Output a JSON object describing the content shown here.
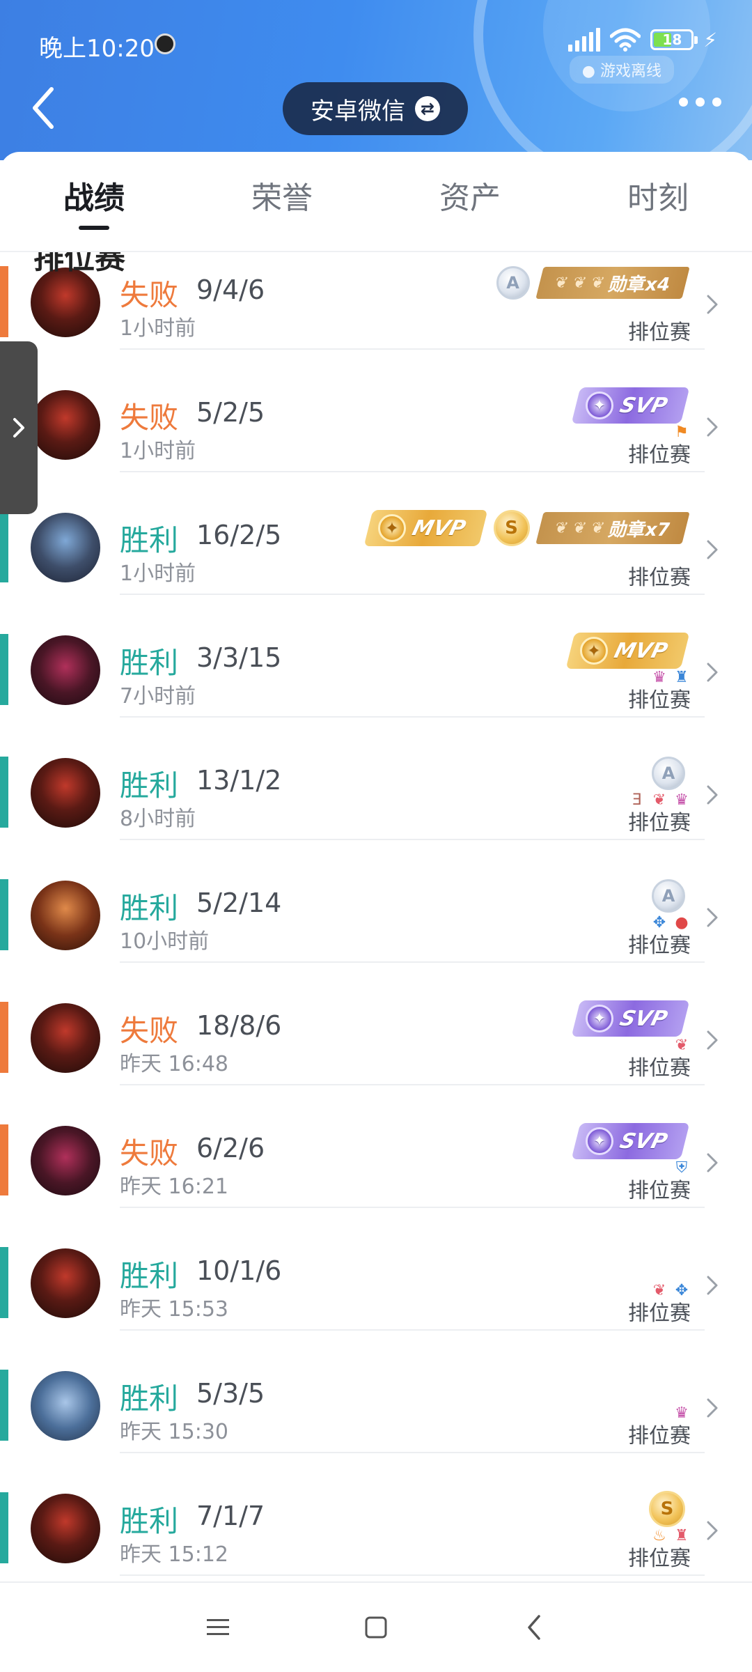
{
  "status_bar": {
    "time": "晚上10:20",
    "battery": "18",
    "game_status": "游戏离线"
  },
  "header": {
    "account": "安卓微信"
  },
  "tabs": [
    {
      "label": "战绩",
      "active": true
    },
    {
      "label": "荣誉",
      "active": false
    },
    {
      "label": "资产",
      "active": false
    },
    {
      "label": "时刻",
      "active": false
    }
  ],
  "section_title": "排位赛",
  "matches": [
    {
      "result": "失败",
      "kda": "9/4/6",
      "time": "1小时前",
      "mode": "排位赛",
      "badges": [
        "A",
        "勋章x4"
      ],
      "extras": []
    },
    {
      "result": "失败",
      "kda": "5/2/5",
      "time": "1小时前",
      "mode": "排位赛",
      "badges": [
        "SVP"
      ],
      "extras": [
        "flag-icon"
      ]
    },
    {
      "result": "胜利",
      "kda": "16/2/5",
      "time": "1小时前",
      "mode": "排位赛",
      "badges": [
        "MVP",
        "S",
        "勋章x7"
      ],
      "extras": []
    },
    {
      "result": "胜利",
      "kda": "3/3/15",
      "time": "7小时前",
      "mode": "排位赛",
      "badges": [
        "MVP"
      ],
      "extras": [
        "demon-icon",
        "tower-icon"
      ]
    },
    {
      "result": "胜利",
      "kda": "13/1/2",
      "time": "8小时前",
      "mode": "排位赛",
      "badges": [
        "A"
      ],
      "extras": [
        "triple-icon",
        "lotus-icon",
        "demon-icon"
      ]
    },
    {
      "result": "胜利",
      "kda": "5/2/14",
      "time": "10小时前",
      "mode": "排位赛",
      "badges": [
        "A"
      ],
      "extras": [
        "support-icon",
        "blood-icon"
      ]
    },
    {
      "result": "失败",
      "kda": "18/8/6",
      "time": "昨天 16:48",
      "mode": "排位赛",
      "badges": [
        "SVP"
      ],
      "extras": [
        "lotus-icon"
      ]
    },
    {
      "result": "失败",
      "kda": "6/2/6",
      "time": "昨天 16:21",
      "mode": "排位赛",
      "badges": [
        "SVP"
      ],
      "extras": [
        "shield-icon"
      ]
    },
    {
      "result": "胜利",
      "kda": "10/1/6",
      "time": "昨天 15:53",
      "mode": "排位赛",
      "badges": [],
      "extras": [
        "lotus-icon",
        "support-icon"
      ]
    },
    {
      "result": "胜利",
      "kda": "5/3/5",
      "time": "昨天 15:30",
      "mode": "排位赛",
      "badges": [],
      "extras": [
        "demon-icon"
      ]
    },
    {
      "result": "胜利",
      "kda": "7/1/7",
      "time": "昨天 15:12",
      "mode": "排位赛",
      "badges": [
        "S"
      ],
      "extras": [
        "fire-icon",
        "tower-red-icon"
      ]
    }
  ],
  "colors": {
    "loss": "#ee7a3c",
    "win": "#26a99d",
    "header_blue": "#3f8cef"
  }
}
